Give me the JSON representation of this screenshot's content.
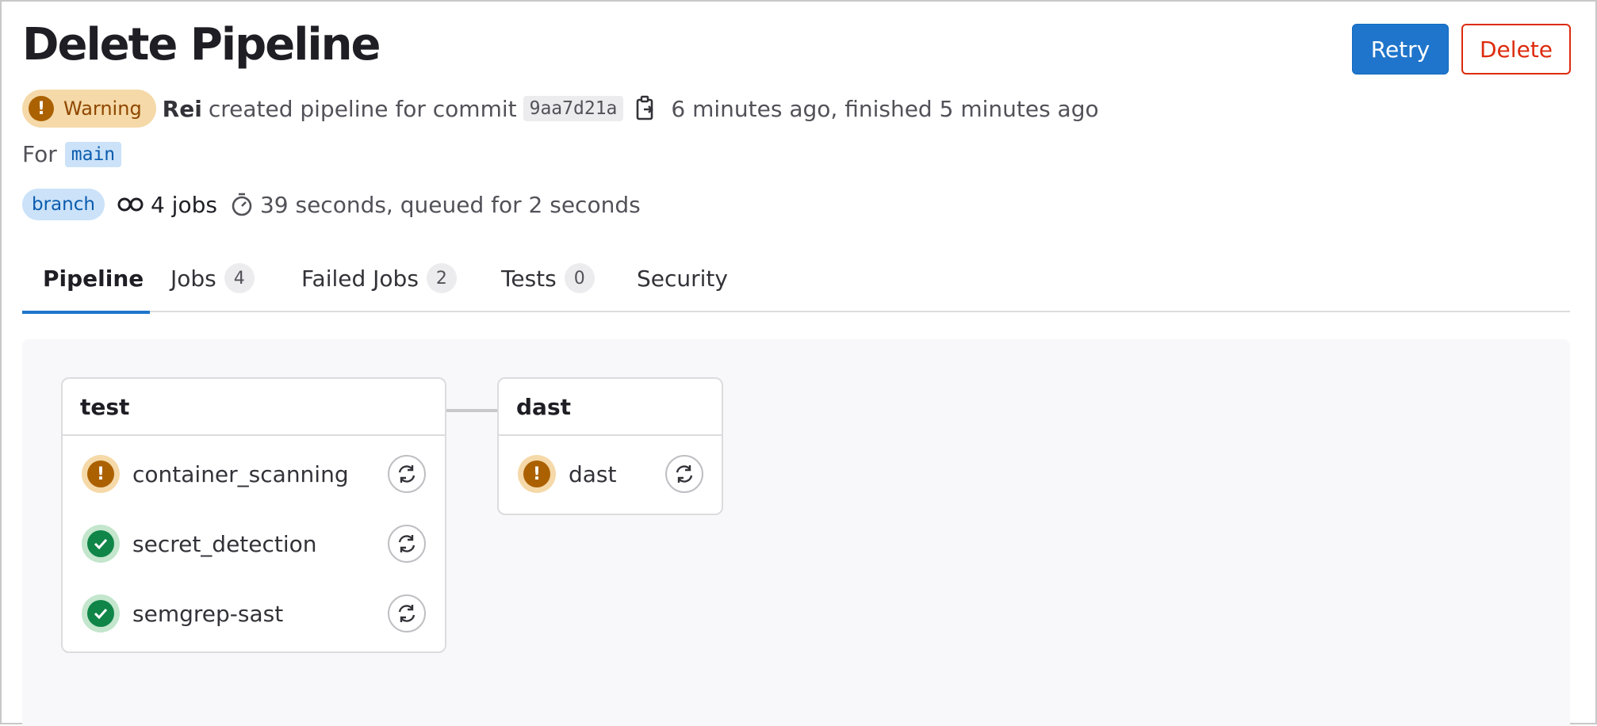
{
  "page": {
    "title": "Delete Pipeline",
    "actions": {
      "retry_label": "Retry",
      "delete_label": "Delete"
    }
  },
  "status": {
    "label": "Warning",
    "icon": "warning-icon",
    "color": "#ab6100"
  },
  "meta": {
    "author": "Rei",
    "created_text": "created pipeline for commit",
    "commit_sha": "9aa7d21a",
    "time_text": "6 minutes ago, finished 5 minutes ago",
    "for_label": "For",
    "ref": "main",
    "ref_type": "branch",
    "jobs_count": "4 jobs",
    "duration_text": "39 seconds, queued for 2 seconds"
  },
  "tabs": [
    {
      "label": "Pipeline",
      "count": null
    },
    {
      "label": "Jobs",
      "count": "4"
    },
    {
      "label": "Failed Jobs",
      "count": "2"
    },
    {
      "label": "Tests",
      "count": "0"
    },
    {
      "label": "Security",
      "count": null
    }
  ],
  "stages": [
    {
      "name": "test",
      "jobs": [
        {
          "name": "container_scanning",
          "status": "warning"
        },
        {
          "name": "secret_detection",
          "status": "success"
        },
        {
          "name": "semgrep-sast",
          "status": "success"
        }
      ]
    },
    {
      "name": "dast",
      "jobs": [
        {
          "name": "dast",
          "status": "warning"
        }
      ]
    }
  ],
  "colors": {
    "primary": "#1f75cb",
    "danger": "#dd2b0e",
    "warning": "#ab6100",
    "success": "#108548"
  }
}
